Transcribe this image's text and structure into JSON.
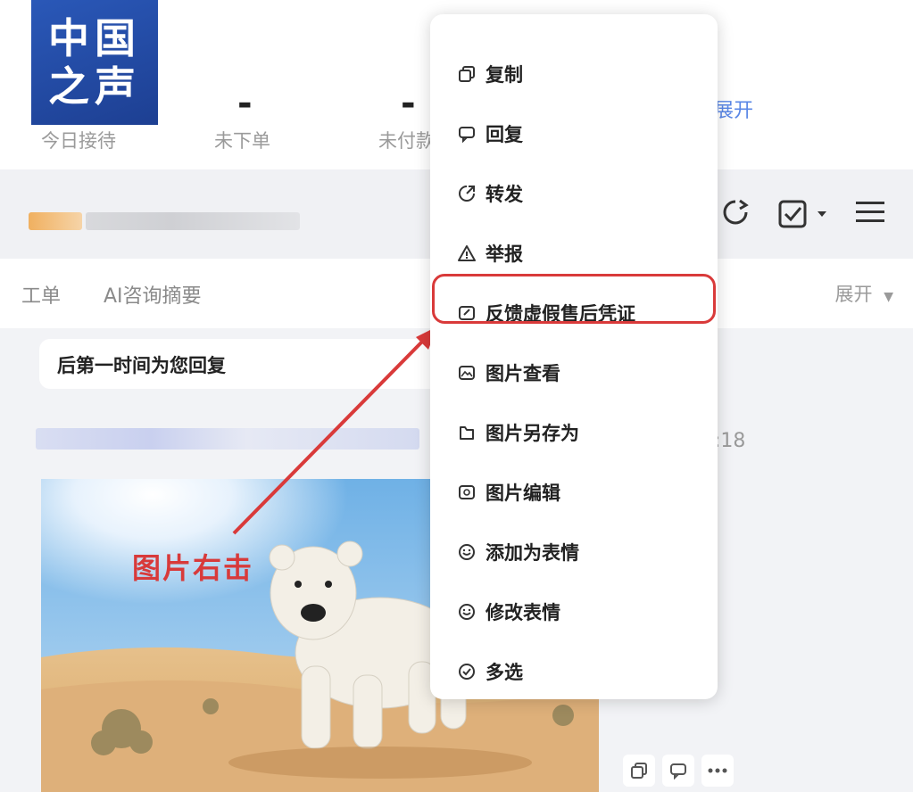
{
  "logo": {
    "line1": "中国",
    "line2": "之声"
  },
  "stats": {
    "items": [
      {
        "value": "-",
        "label": "今日接待"
      },
      {
        "value": "-",
        "label": "未下单"
      },
      {
        "value": "-",
        "label": "未付款"
      }
    ],
    "expand_label": "展开"
  },
  "chat_header": {
    "icons": [
      "refresh-icon",
      "checkbox-add-icon",
      "chevron-down-icon",
      "menu-icon"
    ]
  },
  "tabs": {
    "items": [
      "工单",
      "AI咨询摘要"
    ],
    "expand_label": "展开"
  },
  "chat": {
    "bubble_text": "后第一时间为您回复",
    "time_fragment": ":18",
    "annotation": "图片右击"
  },
  "context_menu": {
    "items": [
      {
        "label": "复制",
        "icon": "copy-icon"
      },
      {
        "label": "回复",
        "icon": "reply-icon"
      },
      {
        "label": "转发",
        "icon": "forward-icon"
      },
      {
        "label": "举报",
        "icon": "warning-icon"
      },
      {
        "label": "反馈虚假售后凭证",
        "icon": "feedback-icon"
      },
      {
        "label": "图片查看",
        "icon": "image-view-icon"
      },
      {
        "label": "图片另存为",
        "icon": "save-icon"
      },
      {
        "label": "图片编辑",
        "icon": "image-edit-icon"
      },
      {
        "label": "添加为表情",
        "icon": "add-emoji-icon"
      },
      {
        "label": "修改表情",
        "icon": "edit-emoji-icon"
      },
      {
        "label": "多选",
        "icon": "multi-select-icon"
      }
    ],
    "highlighted": "反馈虚假售后凭证"
  },
  "colors": {
    "accent_blue": "#5a87e6",
    "highlight_red": "#d93a3a",
    "logo_blue": "#1d3f92"
  }
}
